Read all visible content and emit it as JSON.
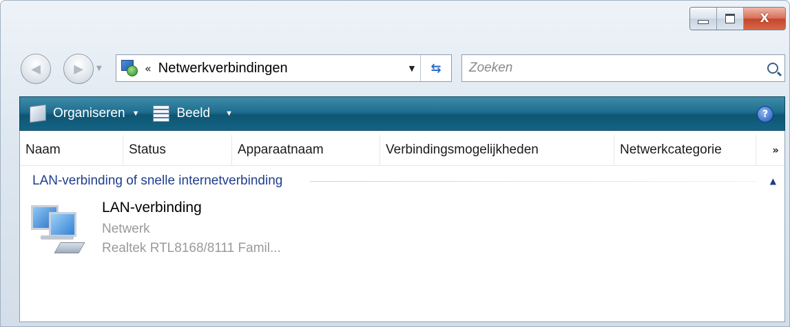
{
  "window": {
    "caption": {
      "minimize": "—",
      "maximize": "□",
      "close": "X"
    }
  },
  "nav": {
    "back": "◀",
    "forward": "▶"
  },
  "address": {
    "chevron": "«",
    "path": "Netwerkverbindingen",
    "icon": "network-folder-icon"
  },
  "search": {
    "placeholder": "Zoeken"
  },
  "toolbar": {
    "organize_label": "Organiseren",
    "view_label": "Beeld",
    "help_label": "?"
  },
  "columns": [
    {
      "label": "Naam"
    },
    {
      "label": "Status"
    },
    {
      "label": "Apparaatnaam"
    },
    {
      "label": "Verbindingsmogelijkheden"
    },
    {
      "label": "Netwerkcategorie"
    }
  ],
  "columns_more": "»",
  "group": {
    "label": "LAN-verbinding of snelle internetverbinding",
    "collapse": "▲"
  },
  "items": [
    {
      "name": "LAN-verbinding",
      "network": "Netwerk",
      "device": "Realtek RTL8168/8111 Famil..."
    }
  ],
  "colors": {
    "toolbar": "#1f6e8f",
    "group_label": "#1e3d8f",
    "close_button": "#c5462c"
  }
}
